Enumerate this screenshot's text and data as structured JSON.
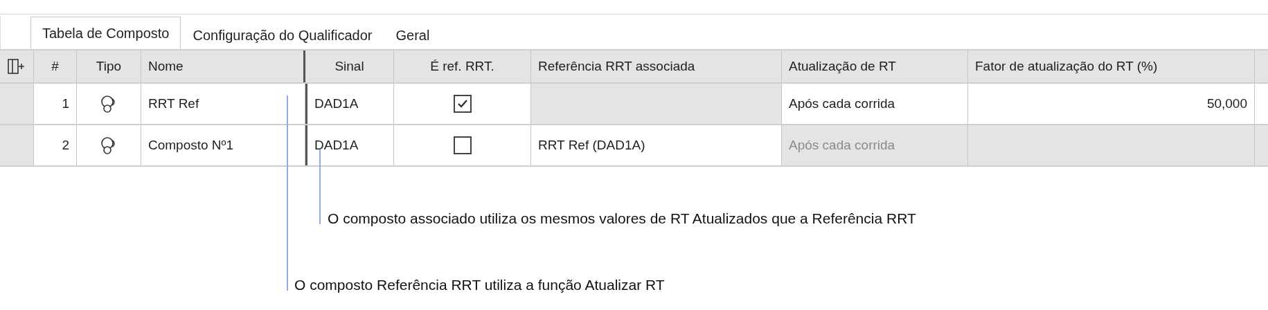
{
  "tabs": [
    {
      "label": "Tabela de Composto",
      "selected": true
    },
    {
      "label": "Configuração do Qualificador",
      "selected": false
    },
    {
      "label": "Geral",
      "selected": false
    }
  ],
  "table": {
    "columns": [
      "#",
      "Tipo",
      "Nome",
      "Sinal",
      "É ref. RRT.",
      "Referência RRT associada",
      "Atualização de RT",
      "Fator de atualização do RT (%)"
    ],
    "rows": [
      {
        "number": "1",
        "name": "RRT Ref",
        "signal": "DAD1A",
        "is_rrt_ref": true,
        "associated_ref": {
          "disabled": true
        },
        "rt_update": {
          "text": "Após cada corrida",
          "disabled": false
        },
        "factor": {
          "text": "50,000",
          "disabled": false
        }
      },
      {
        "number": "2",
        "name": "Composto Nº1",
        "signal": "DAD1A",
        "is_rrt_ref": false,
        "associated_ref": {
          "text": "RRT Ref (DAD1A)",
          "disabled": false
        },
        "rt_update": {
          "text": "Após cada corrida",
          "disabled": true
        },
        "factor": {
          "disabled": true
        }
      }
    ]
  },
  "annotations": [
    {
      "text": "O composto associado utiliza os mesmos valores de RT Atualizados que a Referência RRT"
    },
    {
      "text": "O composto Referência RRT utiliza a função Atualizar RT"
    }
  ]
}
